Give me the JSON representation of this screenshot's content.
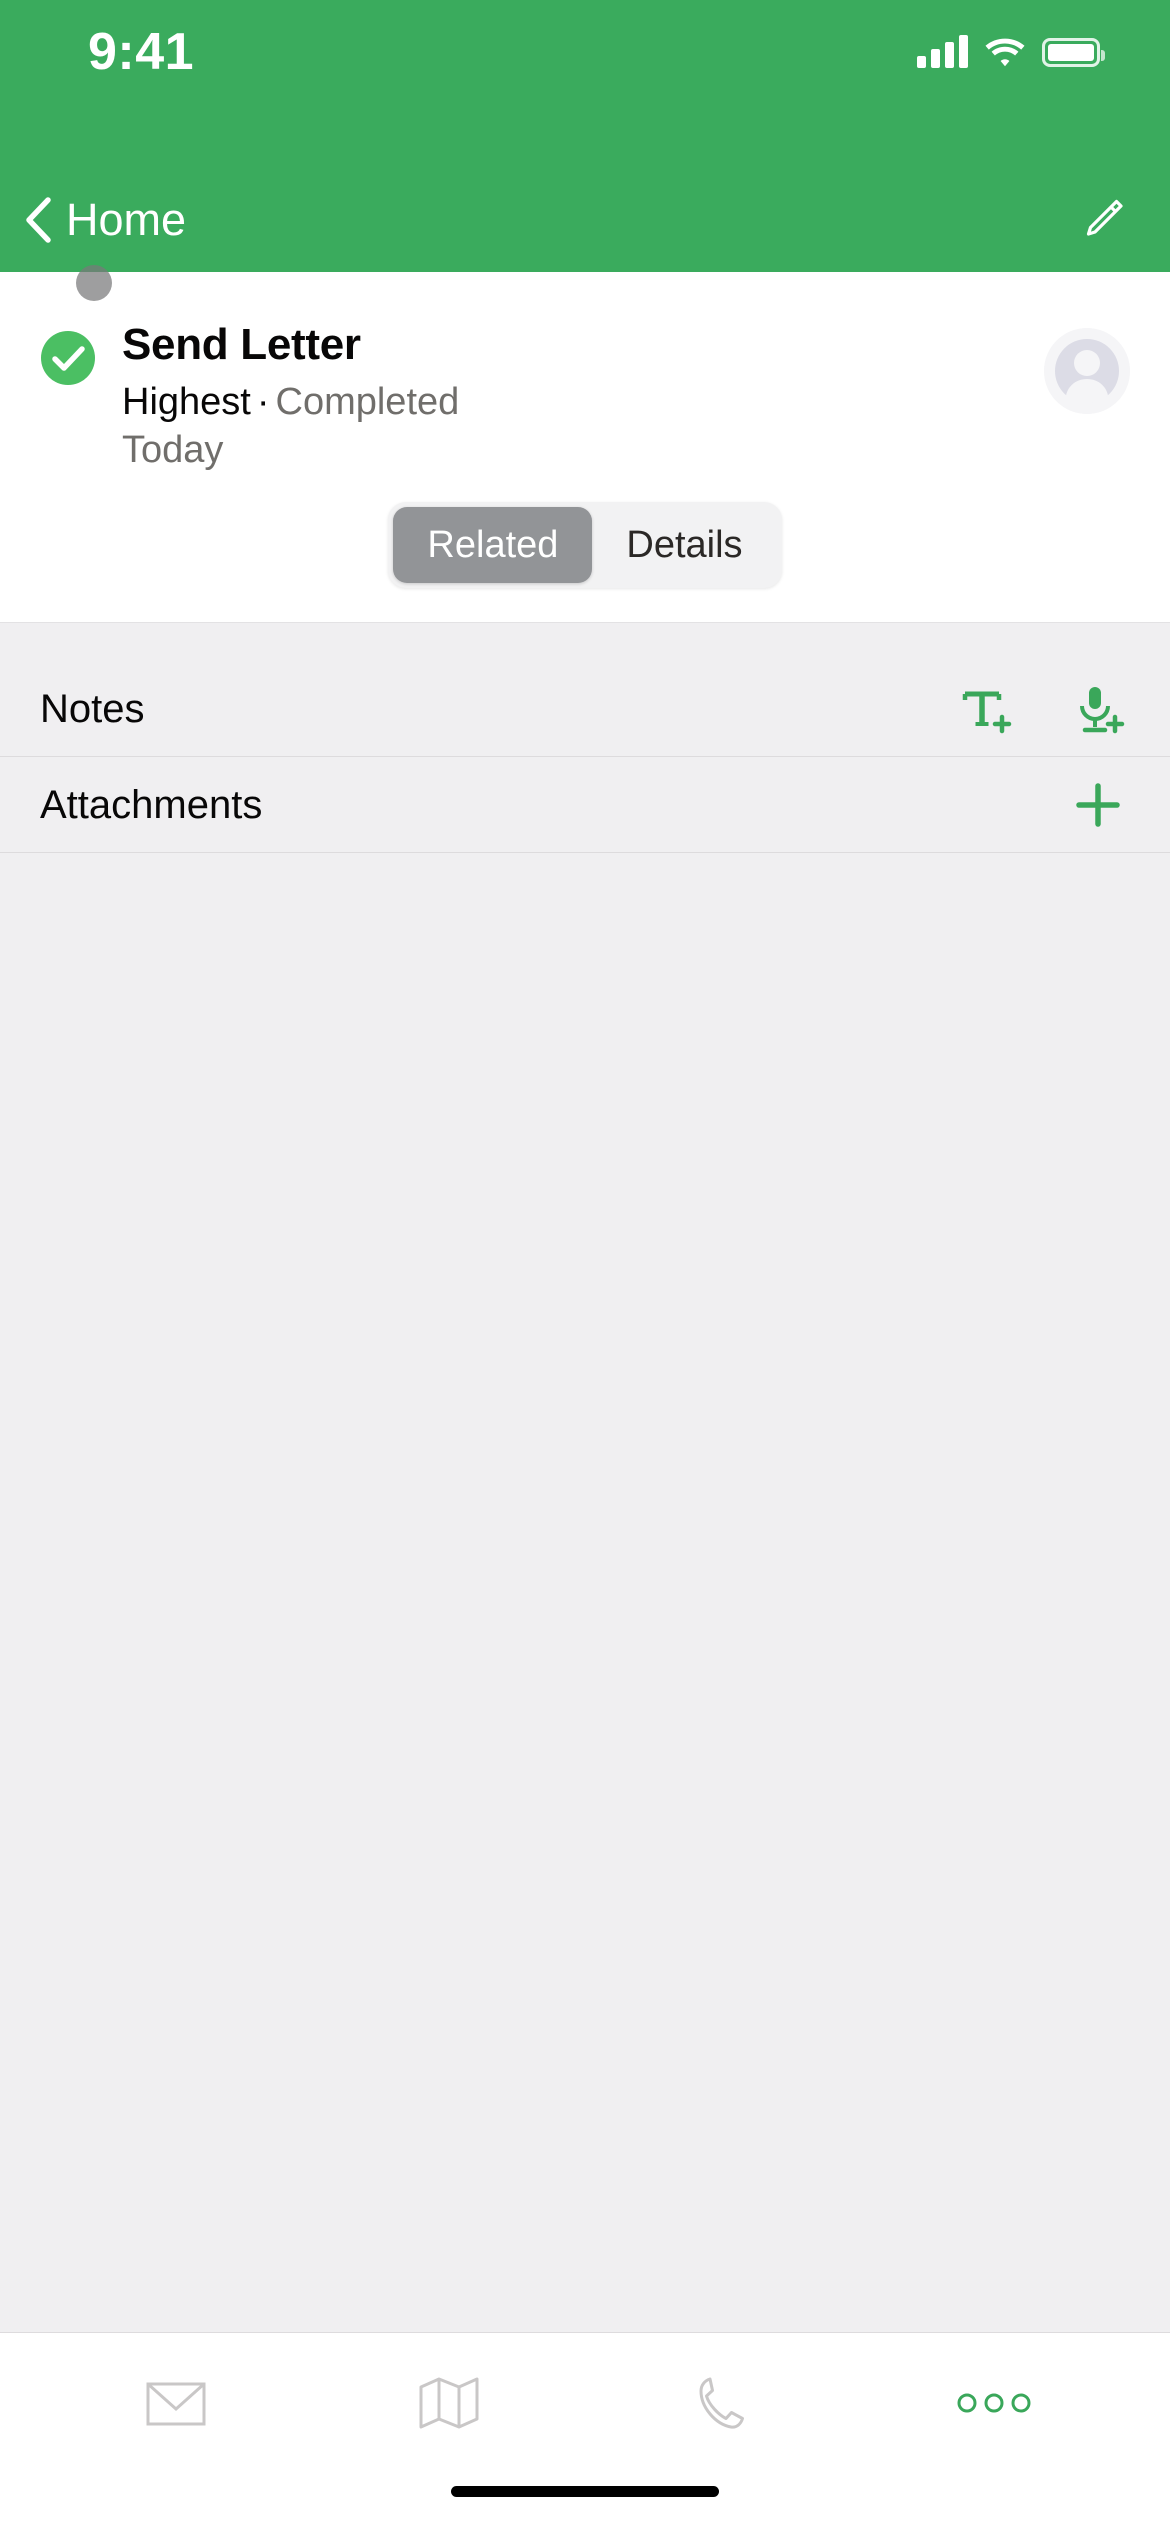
{
  "theme": {
    "brand_green": "#3aab5d",
    "accent_green": "#4bbf63",
    "action_green": "#3aa75a",
    "body_bg": "#f0eff1",
    "text_primary": "#080707",
    "text_secondary": "#706e6b"
  },
  "status_bar": {
    "time": "9:41",
    "signal_icon": "cellular-signal-icon",
    "wifi_icon": "wifi-icon",
    "battery_icon": "battery-icon"
  },
  "nav_bar": {
    "back_icon": "chevron-left-icon",
    "back_label": "Home",
    "edit_icon": "pencil-edit-icon"
  },
  "record": {
    "status_icon": "green-check-circle-icon",
    "title": "Send Letter",
    "priority": "Highest",
    "separator": "·",
    "status": "Completed",
    "date": "Today",
    "avatar_icon": "user-avatar-placeholder-icon"
  },
  "segmented_control": {
    "tabs": [
      {
        "label": "Related",
        "active": true
      },
      {
        "label": "Details",
        "active": false
      }
    ]
  },
  "related_lists": [
    {
      "label": "Notes",
      "actions": [
        {
          "icon": "add-text-note-icon"
        },
        {
          "icon": "add-voice-note-icon"
        }
      ]
    },
    {
      "label": "Attachments",
      "actions": [
        {
          "icon": "add-attachment-plus-icon"
        }
      ]
    }
  ],
  "tab_bar": {
    "items": [
      {
        "icon": "mail-envelope-icon",
        "active": false
      },
      {
        "icon": "map-icon",
        "active": false
      },
      {
        "icon": "phone-icon",
        "active": false
      },
      {
        "icon": "more-dots-icon",
        "active": true
      }
    ]
  },
  "home_indicator": {
    "icon": "home-indicator-bar"
  }
}
